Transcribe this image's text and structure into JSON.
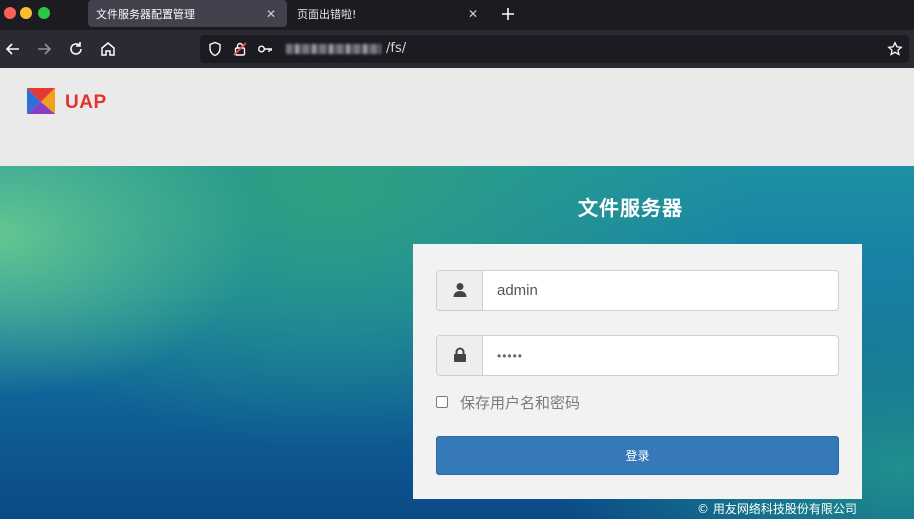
{
  "browser": {
    "tabs": [
      {
        "title": "文件服务器配置管理",
        "active": true
      },
      {
        "title": "页面出错啦!",
        "active": false
      }
    ],
    "url_path": "/fs/"
  },
  "page": {
    "logo_text": "UAP",
    "title": "文件服务器",
    "username_value": "admin",
    "password_value": "•••••",
    "remember_label": "保存用户名和密码",
    "login_label": "登录",
    "copyright": "© 用友网络科技股份有限公司"
  },
  "colors": {
    "accent_button": "#3579b8",
    "logo_red": "#e3322f"
  }
}
